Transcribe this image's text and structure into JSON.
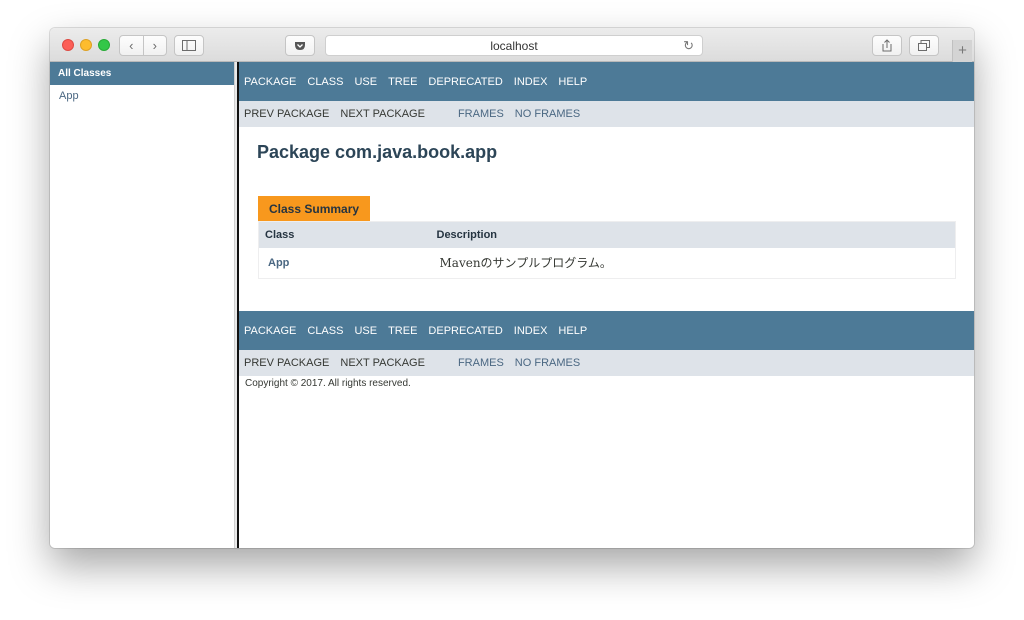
{
  "browser": {
    "address": "localhost",
    "reload_glyph": "↻",
    "newtab_glyph": "+",
    "back_glyph": "‹",
    "forward_glyph": "›"
  },
  "left_frame": {
    "header": "All Classes",
    "classes": [
      "App"
    ]
  },
  "top_nav": {
    "items": [
      "PACKAGE",
      "CLASS",
      "USE",
      "TREE",
      "DEPRECATED",
      "INDEX",
      "HELP"
    ]
  },
  "sub_nav": {
    "prev_package": "PREV PACKAGE",
    "next_package": "NEXT PACKAGE",
    "frames": "FRAMES",
    "no_frames": "NO FRAMES"
  },
  "page": {
    "title": "Package com.java.book.app",
    "summary_caption": "Class Summary",
    "columns": [
      "Class",
      "Description"
    ],
    "rows": [
      {
        "class": "App",
        "description": "Mavenのサンプルプログラム。"
      }
    ]
  },
  "footer": {
    "copyright": "Copyright © 2017. All rights reserved."
  },
  "colors": {
    "nav_bar": "#4d7a97",
    "sub_nav": "#dee3e9",
    "caption": "#f8981d",
    "link": "#4a6782"
  }
}
